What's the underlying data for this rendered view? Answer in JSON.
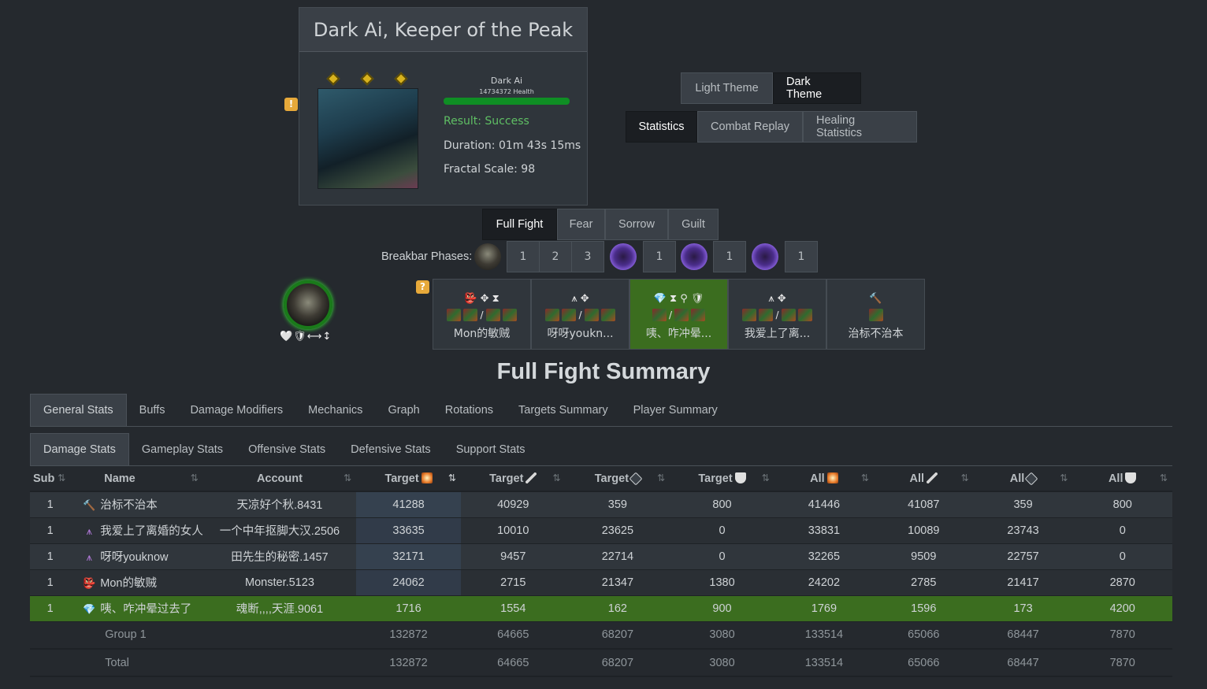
{
  "encounter": {
    "title": "Dark Ai, Keeper of the Peak",
    "boss_name": "Dark Ai",
    "boss_health": "14734372 Health",
    "result": "Result: Success",
    "duration": "Duration: 01m 43s 15ms",
    "fractal_scale": "Fractal Scale: 98",
    "warning_icon": "!",
    "result_color": "#5fbf64"
  },
  "theme_buttons": {
    "light": "Light Theme",
    "dark": "Dark Theme",
    "active": "dark"
  },
  "view_buttons": {
    "statistics": "Statistics",
    "combat_replay": "Combat Replay",
    "healing": "Healing Statistics"
  },
  "phases": [
    "Full Fight",
    "Fear",
    "Sorrow",
    "Guilt"
  ],
  "breakbar": {
    "label": "Breakbar Phases:",
    "buttons": [
      "1",
      "2",
      "3",
      "1",
      "1",
      "1"
    ]
  },
  "help_icon": "?",
  "portrait_icons": "🤍🛡⟷↕",
  "squad": [
    {
      "icons": "👺 ✥ ⧗",
      "name": "Mon的敏贼",
      "highlight": false
    },
    {
      "icons": "⩚ ✥",
      "name": "呀呀youkn...",
      "highlight": false
    },
    {
      "icons": "💎 ⧗ ⚲ 🛡",
      "name": "咦、咋冲晕...",
      "highlight": true
    },
    {
      "icons": "⩚ ✥",
      "name": "我爱上了离...",
      "highlight": false
    },
    {
      "icons": "🔨",
      "name": "治标不治本",
      "highlight": false
    }
  ],
  "summary_title": "Full Fight Summary",
  "main_tabs": [
    "General Stats",
    "Buffs",
    "Damage Modifiers",
    "Mechanics",
    "Graph",
    "Rotations",
    "Targets Summary",
    "Player Summary"
  ],
  "sub_tabs": [
    "Damage Stats",
    "Gameplay Stats",
    "Offensive Stats",
    "Defensive Stats",
    "Support Stats"
  ],
  "table": {
    "headers": [
      "Sub",
      "Name",
      "Account",
      "Target",
      "Target",
      "Target",
      "Target",
      "All",
      "All",
      "All",
      "All"
    ],
    "sort_glyph": "⇅",
    "rows": [
      {
        "sub": "1",
        "icon": "🔨",
        "name": "治标不治本",
        "account": "天凉好个秋.8431",
        "values": [
          "41288",
          "40929",
          "359",
          "800",
          "41446",
          "41087",
          "359",
          "800"
        ]
      },
      {
        "sub": "1",
        "icon": "⩚",
        "name": "我爱上了离婚的女人",
        "account": "一个中年抠脚大汉.2506",
        "values": [
          "33635",
          "10010",
          "23625",
          "0",
          "33831",
          "10089",
          "23743",
          "0"
        ]
      },
      {
        "sub": "1",
        "icon": "⩚",
        "name": "呀呀youknow",
        "account": "田先生的秘密.1457",
        "values": [
          "32171",
          "9457",
          "22714",
          "0",
          "32265",
          "9509",
          "22757",
          "0"
        ]
      },
      {
        "sub": "1",
        "icon": "👺",
        "name": "Mon的敏贼",
        "account": "Monster.5123",
        "values": [
          "24062",
          "2715",
          "21347",
          "1380",
          "24202",
          "2785",
          "21417",
          "2870"
        ]
      },
      {
        "sub": "1",
        "icon": "💎",
        "name": "咦、咋冲晕过去了",
        "account": "魂断,,,,天涯.9061",
        "values": [
          "1716",
          "1554",
          "162",
          "900",
          "1769",
          "1596",
          "173",
          "4200"
        ]
      }
    ],
    "footer": [
      {
        "label": "Group 1",
        "values": [
          "132872",
          "64665",
          "68207",
          "3080",
          "133514",
          "65066",
          "68447",
          "7870"
        ]
      },
      {
        "label": "Total",
        "values": [
          "132872",
          "64665",
          "68207",
          "3080",
          "133514",
          "65066",
          "68447",
          "7870"
        ]
      }
    ]
  },
  "colors": {
    "background": "#25292e",
    "highlight_row": "#3b6d1f",
    "active_button": "#1b1e22",
    "health_bar": "#0f8e24",
    "badge": "#e7a93a"
  }
}
